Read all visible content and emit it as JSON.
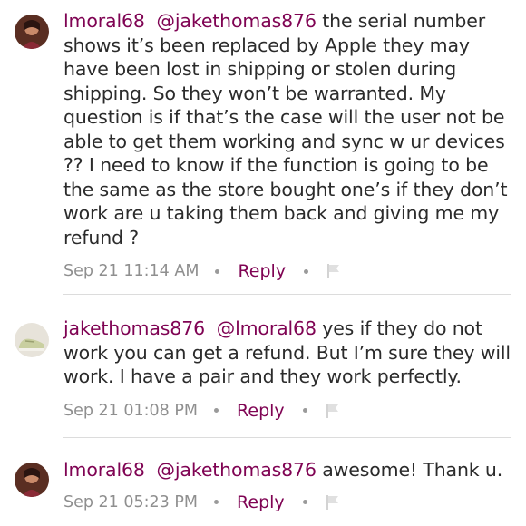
{
  "comments": [
    {
      "author": "lmoral68",
      "mention": "@jakethomas876",
      "text": " the serial number shows it’s been replaced by Apple they may have been lost in shipping or stolen during shipping.  So they won’t be warranted. My question is if that’s the case will the user not be able to get them working and sync w ur devices ?? I need to know if the function is going to be the same as the store bought one’s  if they don’t work are u taking them back and giving me my refund ?",
      "timestamp": "Sep 21 11:14 AM",
      "reply_label": "Reply",
      "avatar_icon": "user-avatar-photo",
      "flag_icon": "flag-icon"
    },
    {
      "author": "jakethomas876",
      "mention": "@lmoral68",
      "text": " yes if they do not work you can get a refund. But I’m sure they will work. I have a pair and they work perfectly.",
      "timestamp": "Sep 21 01:08 PM",
      "reply_label": "Reply",
      "avatar_icon": "sneaker-avatar-photo",
      "flag_icon": "flag-icon"
    },
    {
      "author": "lmoral68",
      "mention": "@jakethomas876",
      "text": " awesome! Thank u.",
      "timestamp": "Sep 21 05:23 PM",
      "reply_label": "Reply",
      "avatar_icon": "user-avatar-photo",
      "flag_icon": "flag-icon"
    }
  ],
  "colors": {
    "link": "#7f0353",
    "text": "#2b2b2b",
    "meta": "#8f8f8f",
    "divider": "#dcdcdc"
  }
}
